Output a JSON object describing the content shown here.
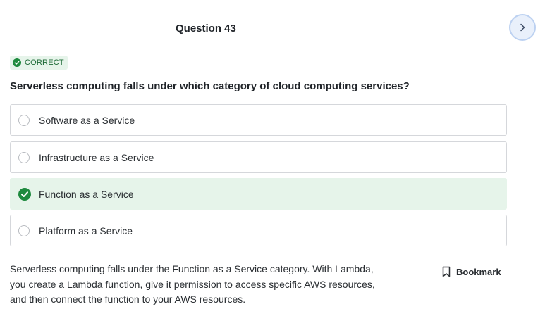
{
  "header": {
    "question_title": "Question 43",
    "next_icon": "chevron-right-icon"
  },
  "status": {
    "label": "CORRECT",
    "icon": "check-circle-icon",
    "color": "#1e8a3e"
  },
  "question": {
    "text": "Serverless computing falls under which category of cloud computing services?"
  },
  "options": [
    {
      "label": "Software as a Service",
      "state": "unselected"
    },
    {
      "label": "Infrastructure as a Service",
      "state": "unselected"
    },
    {
      "label": "Function as a Service",
      "state": "correct"
    },
    {
      "label": "Platform as a Service",
      "state": "unselected"
    }
  ],
  "explanation": {
    "lines": [
      "Serverless computing falls under the Function as a Service category. With Lambda,",
      "you create a Lambda function, give it permission to access specific AWS resources,",
      "and then connect the function to your AWS resources."
    ]
  },
  "bookmark": {
    "label": "Bookmark",
    "icon": "bookmark-icon"
  },
  "colors": {
    "correct_bg": "#e6f4ea",
    "accent_green": "#1e8a3e",
    "next_button_bg": "#e9f0fb"
  }
}
